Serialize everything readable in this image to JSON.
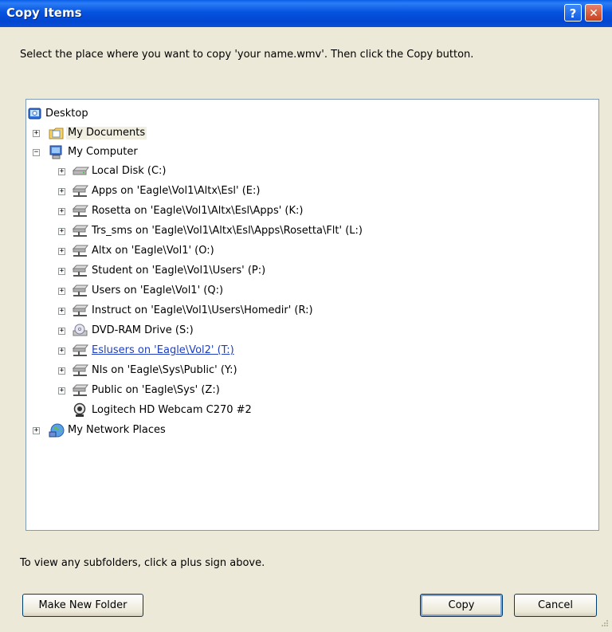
{
  "window": {
    "title": "Copy Items",
    "help_label": "?",
    "close_label": "✕"
  },
  "instruction": "Select the place where you want to copy 'your name.wmv'. Then click the Copy button.",
  "tree": {
    "root": "Desktop",
    "items": [
      {
        "label": "My Documents",
        "expander": "+",
        "icon": "my-documents-icon"
      },
      {
        "label": "My Computer",
        "expander": "−",
        "icon": "my-computer-icon"
      },
      {
        "label": "Local Disk (C:)",
        "expander": "+",
        "icon": "local-disk-icon"
      },
      {
        "label": "Apps on 'Eagle\\Vol1\\Altx\\Esl' (E:)",
        "expander": "+",
        "icon": "network-drive-icon"
      },
      {
        "label": "Rosetta on 'Eagle\\Vol1\\Altx\\Esl\\Apps' (K:)",
        "expander": "+",
        "icon": "network-drive-icon"
      },
      {
        "label": "Trs_sms on 'Eagle\\Vol1\\Altx\\Esl\\Apps\\Rosetta\\Flt' (L:)",
        "expander": "+",
        "icon": "network-drive-icon"
      },
      {
        "label": "Altx on 'Eagle\\Vol1' (O:)",
        "expander": "+",
        "icon": "network-drive-icon"
      },
      {
        "label": "Student on 'Eagle\\Vol1\\Users' (P:)",
        "expander": "+",
        "icon": "network-drive-icon"
      },
      {
        "label": "Users on 'Eagle\\Vol1' (Q:)",
        "expander": "+",
        "icon": "network-drive-icon"
      },
      {
        "label": "Instruct on 'Eagle\\Vol1\\Users\\Homedir' (R:)",
        "expander": "+",
        "icon": "network-drive-icon"
      },
      {
        "label": "DVD-RAM Drive (S:)",
        "expander": "+",
        "icon": "dvd-drive-icon"
      },
      {
        "label": "Eslusers on 'Eagle\\Vol2' (T:)",
        "expander": "+",
        "icon": "network-drive-icon"
      },
      {
        "label": "Nls on 'Eagle\\Sys\\Public' (Y:)",
        "expander": "+",
        "icon": "network-drive-icon"
      },
      {
        "label": "Public on 'Eagle\\Sys' (Z:)",
        "expander": "+",
        "icon": "network-drive-icon"
      },
      {
        "label": "Logitech HD Webcam C270 #2",
        "expander": "",
        "icon": "webcam-icon"
      },
      {
        "label": "My Network Places",
        "expander": "+",
        "icon": "network-places-icon"
      }
    ]
  },
  "hint": "To view any subfolders, click a plus sign above.",
  "buttons": {
    "new_folder": "Make New Folder",
    "copy": "Copy",
    "cancel": "Cancel"
  }
}
